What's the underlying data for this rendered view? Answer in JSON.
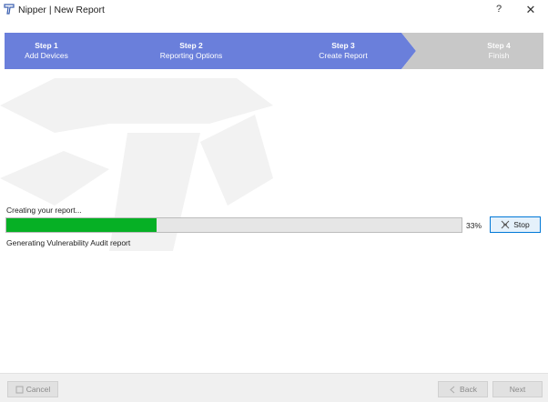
{
  "window": {
    "title": "Nipper | New Report",
    "help_label": "?",
    "close_label": "✕"
  },
  "wizard": {
    "steps": [
      {
        "number": "Step 1",
        "label": "Add Devices",
        "state": "active"
      },
      {
        "number": "Step 2",
        "label": "Reporting Options",
        "state": "active"
      },
      {
        "number": "Step 3",
        "label": "Create Report",
        "state": "active"
      },
      {
        "number": "Step 4",
        "label": "Finish",
        "state": "inactive"
      }
    ],
    "active_color": "#6a7fdb",
    "inactive_color": "#c8c8c8"
  },
  "progress": {
    "heading": "Creating your report...",
    "fraction": 0.33,
    "percent_label": "33%",
    "fill_color": "#06b025",
    "detail": "Generating Vulnerability Audit report",
    "stop_label": "Stop",
    "stop_icon": "stop-icon"
  },
  "footer": {
    "cancel_label": "Cancel",
    "back_label": "Back",
    "next_label": "Next"
  }
}
